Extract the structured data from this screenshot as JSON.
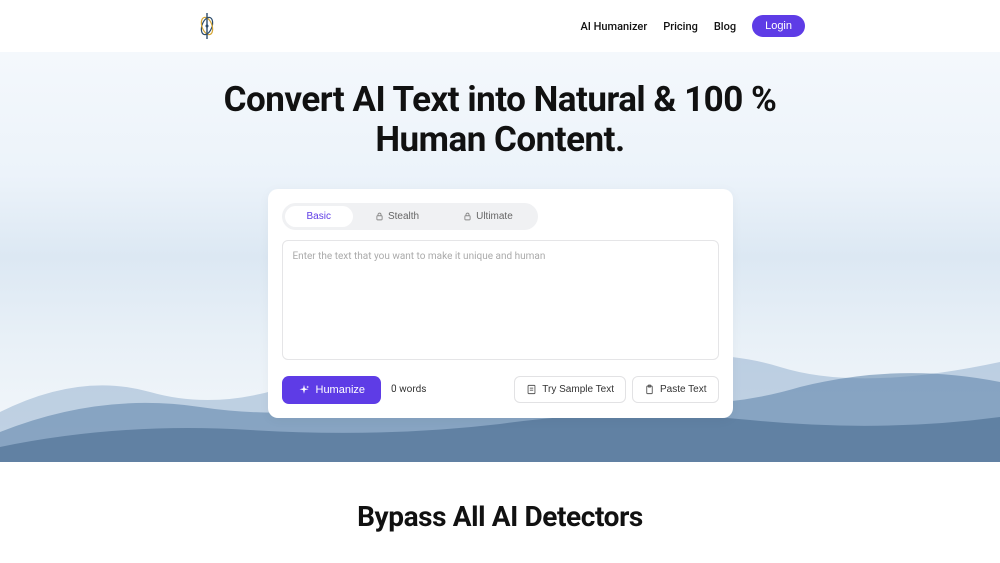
{
  "nav": {
    "items": [
      "AI Humanizer",
      "Pricing",
      "Blog"
    ],
    "login": "Login"
  },
  "hero": {
    "title_l1": "Convert AI Text into Natural & 100 %",
    "title_l2": "Human Content."
  },
  "tabs": {
    "basic": "Basic",
    "stealth": "Stealth",
    "ultimate": "Ultimate"
  },
  "textarea": {
    "placeholder": "Enter the text that you want to make it unique and human"
  },
  "actions": {
    "humanize": "Humanize",
    "word_count": "0 words",
    "sample": "Try Sample Text",
    "paste": "Paste Text"
  },
  "section2": {
    "title": "Bypass All AI Detectors"
  }
}
